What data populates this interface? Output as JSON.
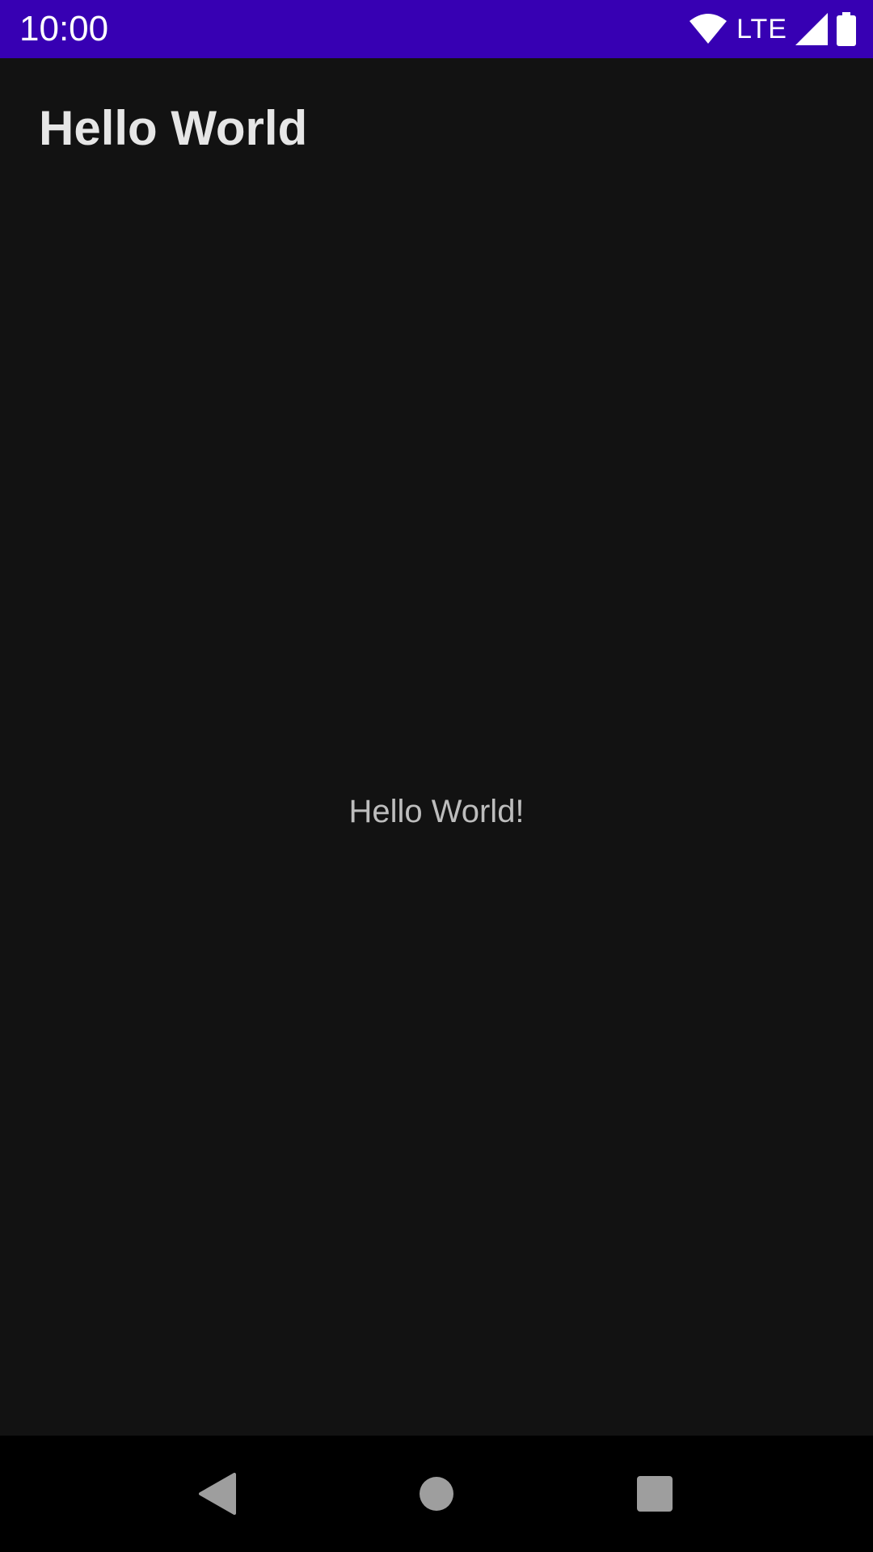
{
  "status_bar": {
    "time": "10:00",
    "network_label": "LTE",
    "background_color": "#3700b3",
    "icons": [
      "wifi-icon",
      "cell-signal-icon",
      "battery-icon"
    ]
  },
  "app_bar": {
    "title": "Hello World"
  },
  "content": {
    "message": "Hello World!"
  },
  "nav_bar": {
    "buttons": [
      "back-icon",
      "home-icon",
      "recents-icon"
    ]
  }
}
